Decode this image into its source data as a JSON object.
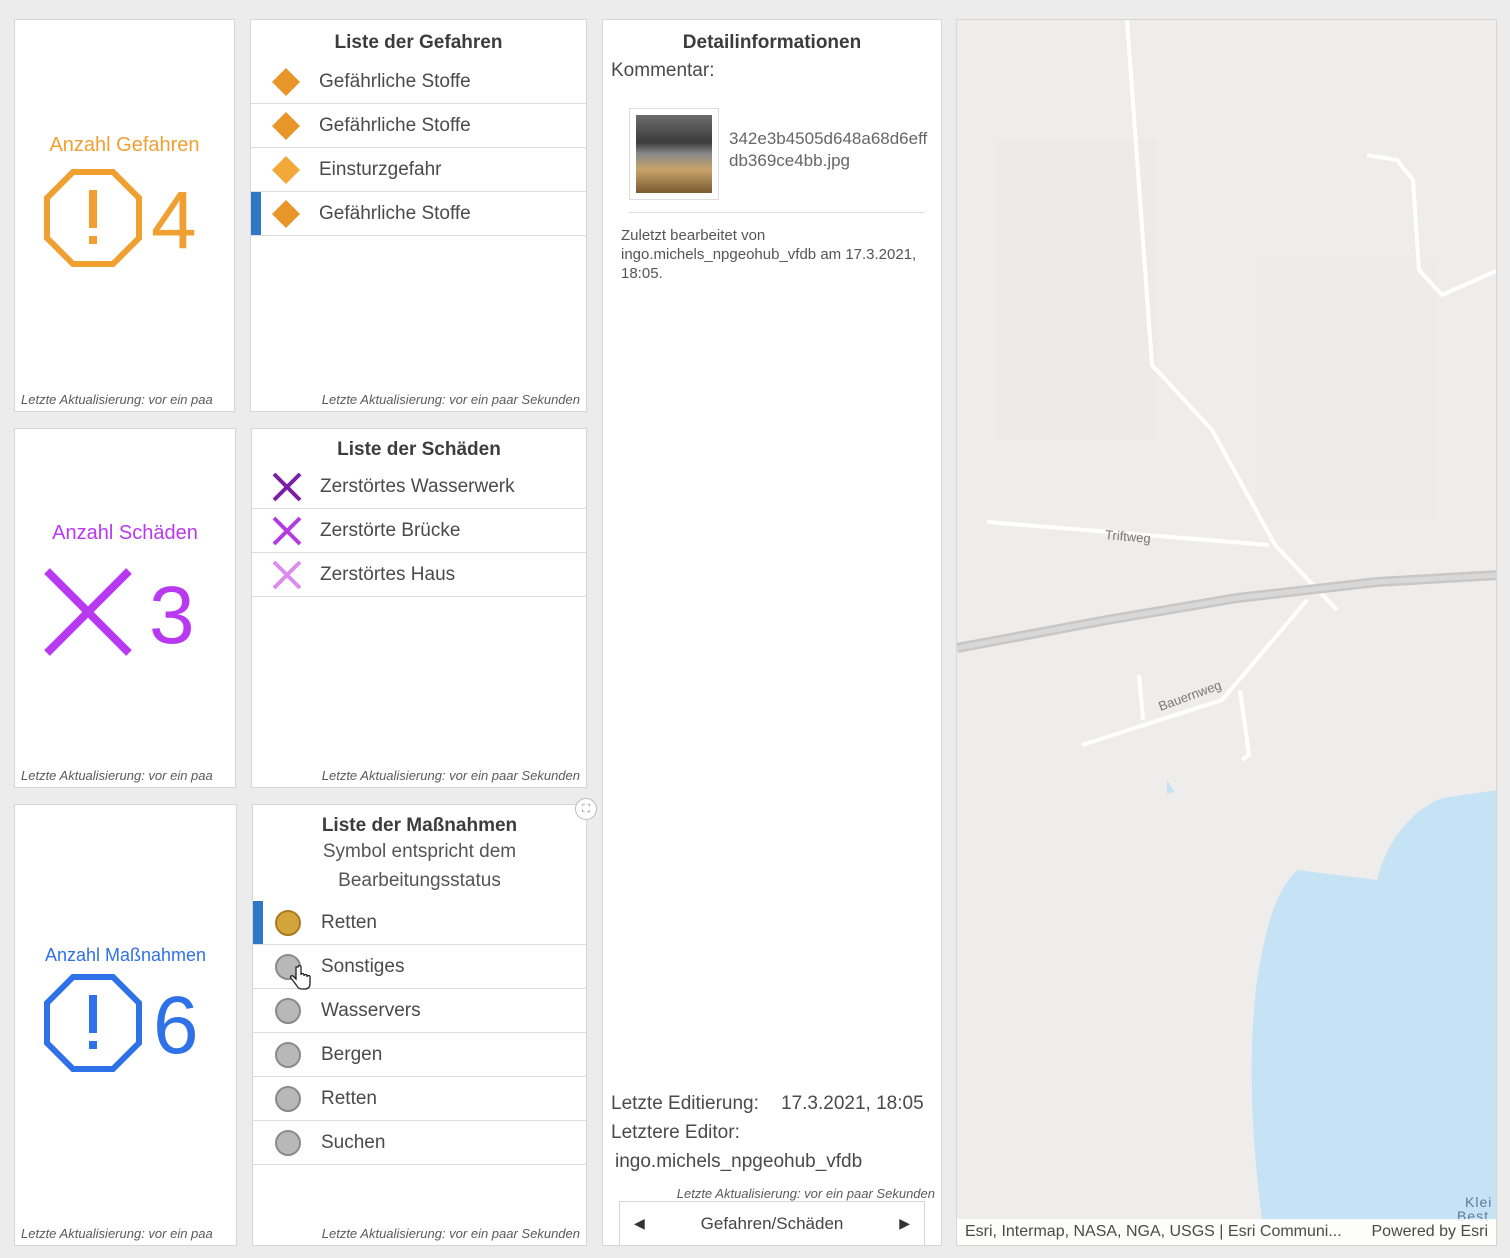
{
  "counters": [
    {
      "label": "Anzahl Gefahren",
      "value": "4",
      "color": "#f0a030",
      "icon": "warning-octagon-icon",
      "footer": "Letzte Aktualisierung: vor ein paa"
    },
    {
      "label": "Anzahl Schäden",
      "value": "3",
      "color": "#b839f0",
      "icon": "x-mark-icon",
      "footer": "Letzte Aktualisierung: vor ein paa"
    },
    {
      "label": "Anzahl Maßnahmen",
      "value": "6",
      "color": "#2f72e8",
      "icon": "warning-octagon-icon",
      "footer": "Letzte Aktualisierung: vor ein paa"
    }
  ],
  "hazards": {
    "title": "Liste der Gefahren",
    "items": [
      {
        "label": "Gefährliche Stoffe",
        "selected": false
      },
      {
        "label": "Gefährliche Stoffe",
        "selected": false
      },
      {
        "label": "Einsturzgefahr",
        "selected": false
      },
      {
        "label": "Gefährliche Stoffe",
        "selected": true
      }
    ],
    "footer": "Letzte Aktualisierung: vor ein paar Sekunden"
  },
  "damages": {
    "title": "Liste der Schäden",
    "items": [
      {
        "label": "Zerstörtes Wasserwerk",
        "color": "#7b1fa2"
      },
      {
        "label": "Zerstörte Brücke",
        "color": "#b33be0"
      },
      {
        "label": "Zerstörtes Haus",
        "color": "#dc8cf0"
      }
    ],
    "footer": "Letzte Aktualisierung: vor ein paar Sekunden"
  },
  "measures": {
    "title": "Liste der Maßnahmen",
    "subtitle_line1": "Symbol entspricht dem",
    "subtitle_line2": "Bearbeitungsstatus",
    "items": [
      {
        "label": "Retten",
        "status": "gold",
        "selected": true
      },
      {
        "label": "Sonstiges",
        "status": "grey",
        "selected": false
      },
      {
        "label": "Wasservers",
        "status": "grey",
        "selected": false
      },
      {
        "label": "Bergen",
        "status": "grey",
        "selected": false
      },
      {
        "label": "Retten",
        "status": "grey",
        "selected": false
      },
      {
        "label": "Suchen",
        "status": "grey",
        "selected": false
      }
    ],
    "footer": "Letzte Aktualisierung: vor ein paar Sekunden"
  },
  "details": {
    "title": "Detailinformationen",
    "comment_label": "Kommentar:",
    "attachment_name": "342e3b4505d648a68d6effdb369ce4bb.jpg",
    "edit_note": "Zuletzt bearbeitet von ingo.michels_npgeohub_vfdb am 17.3.2021, 18:05.",
    "last_edit_label": "Letzte Editierung:",
    "last_edit_value": "17.3.2021, 18:05",
    "last_editor_label": "Letztere Editor:",
    "last_editor_value": "ingo.michels_npgeohub_vfdb",
    "footer": "Letzte Aktualisierung: vor ein paar Sekunden",
    "pager_label": "Gefahren/Schäden"
  },
  "map": {
    "road_label_1": "Triftweg",
    "road_label_2": "Bauernweg",
    "water_label_1": "Klei",
    "water_label_2": "Best",
    "attribution": "Esri, Intermap, NASA, NGA, USGS | Esri Communi...",
    "powered_by": "Powered by Esri"
  }
}
